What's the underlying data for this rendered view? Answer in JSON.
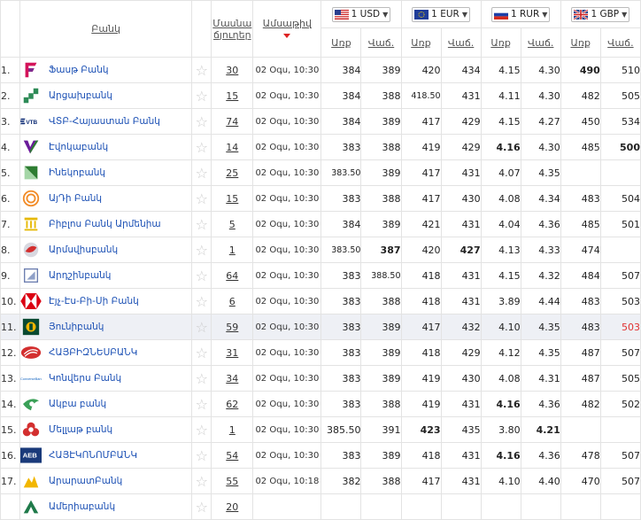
{
  "header": {
    "bank": "Բանկ",
    "branches_line1": "Մասնա",
    "branches_line2": "ճյուղեր",
    "date": "Ամսաթիվ",
    "currencies": [
      {
        "label": "1 USD",
        "flag": "us-flag-icon"
      },
      {
        "label": "1 EUR",
        "flag": "eu-flag-icon"
      },
      {
        "label": "1 RUR",
        "flag": "ru-flag-icon"
      },
      {
        "label": "1 GBP",
        "flag": "gb-flag-icon"
      }
    ],
    "buy": "Առք",
    "sell": "Վաճ."
  },
  "rows": [
    {
      "n": "1.",
      "bank": "Ֆասթ Բանկ",
      "logo": "fast-bank-logo",
      "branches": "30",
      "date": "02 Օգս, 10:30",
      "rates": [
        {
          "v": "384"
        },
        {
          "v": "389"
        },
        {
          "v": "420"
        },
        {
          "v": "434"
        },
        {
          "v": "4.15"
        },
        {
          "v": "4.30"
        },
        {
          "v": "490",
          "b": true
        },
        {
          "v": "510"
        }
      ]
    },
    {
      "n": "2.",
      "bank": "Արցախբանկ",
      "logo": "artsakhbank-logo",
      "branches": "15",
      "date": "02 Օգս, 10:30",
      "rates": [
        {
          "v": "384"
        },
        {
          "v": "388"
        },
        {
          "v": "418.50",
          "s": true
        },
        {
          "v": "431"
        },
        {
          "v": "4.11"
        },
        {
          "v": "4.30"
        },
        {
          "v": "482"
        },
        {
          "v": "505"
        }
      ]
    },
    {
      "n": "3.",
      "bank": "ՎՏԲ-Հայաստան Բանկ",
      "logo": "vtb-logo",
      "branches": "74",
      "date": "02 Օգս, 10:30",
      "rates": [
        {
          "v": "384"
        },
        {
          "v": "389"
        },
        {
          "v": "417"
        },
        {
          "v": "429"
        },
        {
          "v": "4.15"
        },
        {
          "v": "4.27"
        },
        {
          "v": "450"
        },
        {
          "v": "534"
        }
      ]
    },
    {
      "n": "4.",
      "bank": "Էվոկաբանկ",
      "logo": "evocabank-logo",
      "branches": "14",
      "date": "02 Օգս, 10:30",
      "rates": [
        {
          "v": "383"
        },
        {
          "v": "388"
        },
        {
          "v": "419"
        },
        {
          "v": "429"
        },
        {
          "v": "4.16",
          "b": true
        },
        {
          "v": "4.30"
        },
        {
          "v": "485"
        },
        {
          "v": "500",
          "b": true
        }
      ]
    },
    {
      "n": "5.",
      "bank": "Ինեկոբանկ",
      "logo": "inecobank-logo",
      "branches": "25",
      "date": "02 Օգս, 10:30",
      "rates": [
        {
          "v": "383.50",
          "s": true
        },
        {
          "v": "389"
        },
        {
          "v": "417"
        },
        {
          "v": "431"
        },
        {
          "v": "4.07"
        },
        {
          "v": "4.35"
        },
        {
          "v": ""
        },
        {
          "v": ""
        }
      ]
    },
    {
      "n": "6.",
      "bank": "ԱյԴի Բանկ",
      "logo": "idbank-logo",
      "branches": "15",
      "date": "02 Օգս, 10:30",
      "rates": [
        {
          "v": "383"
        },
        {
          "v": "388"
        },
        {
          "v": "417"
        },
        {
          "v": "430"
        },
        {
          "v": "4.08"
        },
        {
          "v": "4.34"
        },
        {
          "v": "483"
        },
        {
          "v": "504"
        }
      ]
    },
    {
      "n": "7.",
      "bank": "Բիբլոս Բանկ Արմենիա",
      "logo": "byblos-bank-logo",
      "branches": "5",
      "date": "02 Օգս, 10:30",
      "rates": [
        {
          "v": "384"
        },
        {
          "v": "389"
        },
        {
          "v": "421"
        },
        {
          "v": "431"
        },
        {
          "v": "4.04"
        },
        {
          "v": "4.36"
        },
        {
          "v": "485"
        },
        {
          "v": "501"
        }
      ]
    },
    {
      "n": "8.",
      "bank": "Արմսվիսբանկ",
      "logo": "armswissbank-logo",
      "branches": "1",
      "date": "02 Օգս, 10:30",
      "rates": [
        {
          "v": "383.50",
          "s": true
        },
        {
          "v": "387",
          "b": true
        },
        {
          "v": "420"
        },
        {
          "v": "427",
          "b": true
        },
        {
          "v": "4.13"
        },
        {
          "v": "4.33"
        },
        {
          "v": "474"
        },
        {
          "v": ""
        }
      ]
    },
    {
      "n": "9.",
      "bank": "Արդշինբանկ",
      "logo": "ardshinbank-logo",
      "branches": "64",
      "date": "02 Օգս, 10:30",
      "rates": [
        {
          "v": "383"
        },
        {
          "v": "388.50",
          "s": true
        },
        {
          "v": "418"
        },
        {
          "v": "431"
        },
        {
          "v": "4.15"
        },
        {
          "v": "4.32"
        },
        {
          "v": "484"
        },
        {
          "v": "507"
        }
      ]
    },
    {
      "n": "10.",
      "bank": "Էյչ-Էս-Բի-Սի Բանկ",
      "logo": "hsbc-logo",
      "branches": "6",
      "date": "02 Օգս, 10:30",
      "rates": [
        {
          "v": "383"
        },
        {
          "v": "388"
        },
        {
          "v": "418"
        },
        {
          "v": "431"
        },
        {
          "v": "3.89"
        },
        {
          "v": "4.44"
        },
        {
          "v": "483"
        },
        {
          "v": "503"
        }
      ]
    },
    {
      "n": "11.",
      "bank": "Յունիբանկ",
      "logo": "unibank-logo",
      "branches": "59",
      "date": "02 Օգս, 10:30",
      "highlight": true,
      "rates": [
        {
          "v": "383"
        },
        {
          "v": "389"
        },
        {
          "v": "417"
        },
        {
          "v": "432"
        },
        {
          "v": "4.10"
        },
        {
          "v": "4.35"
        },
        {
          "v": "483"
        },
        {
          "v": "503",
          "r": true
        }
      ]
    },
    {
      "n": "12.",
      "bank": "ՀԱՅԲԻԶՆԵՍԲԱՆԿ",
      "logo": "armbusinessbank-logo",
      "branches": "31",
      "date": "02 Օգս, 10:30",
      "rates": [
        {
          "v": "383"
        },
        {
          "v": "389"
        },
        {
          "v": "418"
        },
        {
          "v": "429"
        },
        {
          "v": "4.12"
        },
        {
          "v": "4.35"
        },
        {
          "v": "487"
        },
        {
          "v": "507"
        }
      ]
    },
    {
      "n": "13.",
      "bank": "Կոնվերս Բանկ",
      "logo": "converse-bank-logo",
      "branches": "34",
      "date": "02 Օգս, 10:30",
      "rates": [
        {
          "v": "383"
        },
        {
          "v": "389"
        },
        {
          "v": "419"
        },
        {
          "v": "430"
        },
        {
          "v": "4.08"
        },
        {
          "v": "4.31"
        },
        {
          "v": "487"
        },
        {
          "v": "505"
        }
      ]
    },
    {
      "n": "14.",
      "bank": "Ակբա բանկ",
      "logo": "acba-bank-logo",
      "branches": "62",
      "date": "02 Օգս, 10:30",
      "rates": [
        {
          "v": "383"
        },
        {
          "v": "388"
        },
        {
          "v": "419"
        },
        {
          "v": "431"
        },
        {
          "v": "4.16",
          "b": true
        },
        {
          "v": "4.36"
        },
        {
          "v": "482"
        },
        {
          "v": "502"
        }
      ]
    },
    {
      "n": "15.",
      "bank": "Մելլաթ բանկ",
      "logo": "mellat-bank-logo",
      "branches": "1",
      "date": "02 Օգս, 10:30",
      "rates": [
        {
          "v": "385.50"
        },
        {
          "v": "391"
        },
        {
          "v": "423",
          "b": true
        },
        {
          "v": "435"
        },
        {
          "v": "3.80"
        },
        {
          "v": "4.21",
          "b": true
        },
        {
          "v": ""
        },
        {
          "v": ""
        }
      ]
    },
    {
      "n": "16.",
      "bank": "ՀԱՅԷԿՈՆՈՄԲԱՆԿ",
      "logo": "aeb-logo",
      "branches": "54",
      "date": "02 Օգս, 10:30",
      "rates": [
        {
          "v": "383"
        },
        {
          "v": "389"
        },
        {
          "v": "418"
        },
        {
          "v": "431"
        },
        {
          "v": "4.16",
          "b": true
        },
        {
          "v": "4.36"
        },
        {
          "v": "478"
        },
        {
          "v": "507"
        }
      ]
    },
    {
      "n": "17.",
      "bank": "ԱրարատԲանկ",
      "logo": "araratbank-logo",
      "branches": "55",
      "date": "02 Օգս, 10:18",
      "rates": [
        {
          "v": "382"
        },
        {
          "v": "388"
        },
        {
          "v": "417"
        },
        {
          "v": "431"
        },
        {
          "v": "4.10"
        },
        {
          "v": "4.40"
        },
        {
          "v": "470"
        },
        {
          "v": "507"
        }
      ]
    },
    {
      "n": "",
      "bank": "Ամերիաբանկ",
      "logo": "ameriabank-logo",
      "branches": "20",
      "date": "",
      "rates": [
        {
          "v": ""
        },
        {
          "v": ""
        },
        {
          "v": ""
        },
        {
          "v": ""
        },
        {
          "v": ""
        },
        {
          "v": ""
        },
        {
          "v": ""
        },
        {
          "v": ""
        }
      ]
    }
  ],
  "colors": {
    "link": "#1a4fb4",
    "highlight_row": "#eef0f5",
    "red_value": "#e03030"
  }
}
